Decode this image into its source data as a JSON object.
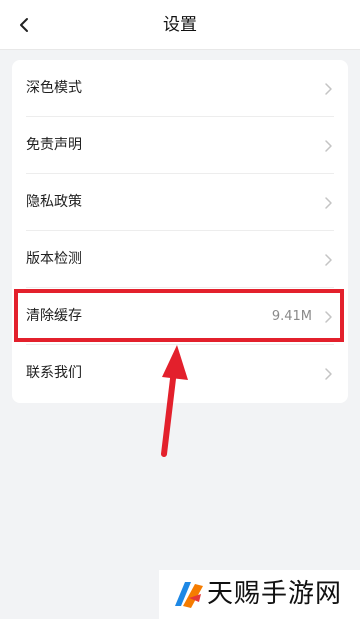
{
  "header": {
    "title": "设置",
    "back_icon": "chevron-left-icon"
  },
  "settings": {
    "items": [
      {
        "label": "深色模式",
        "value": ""
      },
      {
        "label": "免责声明",
        "value": ""
      },
      {
        "label": "隐私政策",
        "value": ""
      },
      {
        "label": "版本检测",
        "value": ""
      },
      {
        "label": "清除缓存",
        "value": "9.41M"
      },
      {
        "label": "联系我们",
        "value": ""
      }
    ]
  },
  "annotation": {
    "highlight_color": "#e3202c",
    "highlighted_item": "清除缓存"
  },
  "watermark": {
    "text": "天赐手游网"
  },
  "colors": {
    "background": "#f2f3f5",
    "card": "#ffffff",
    "chevron": "#c4c4c4"
  }
}
